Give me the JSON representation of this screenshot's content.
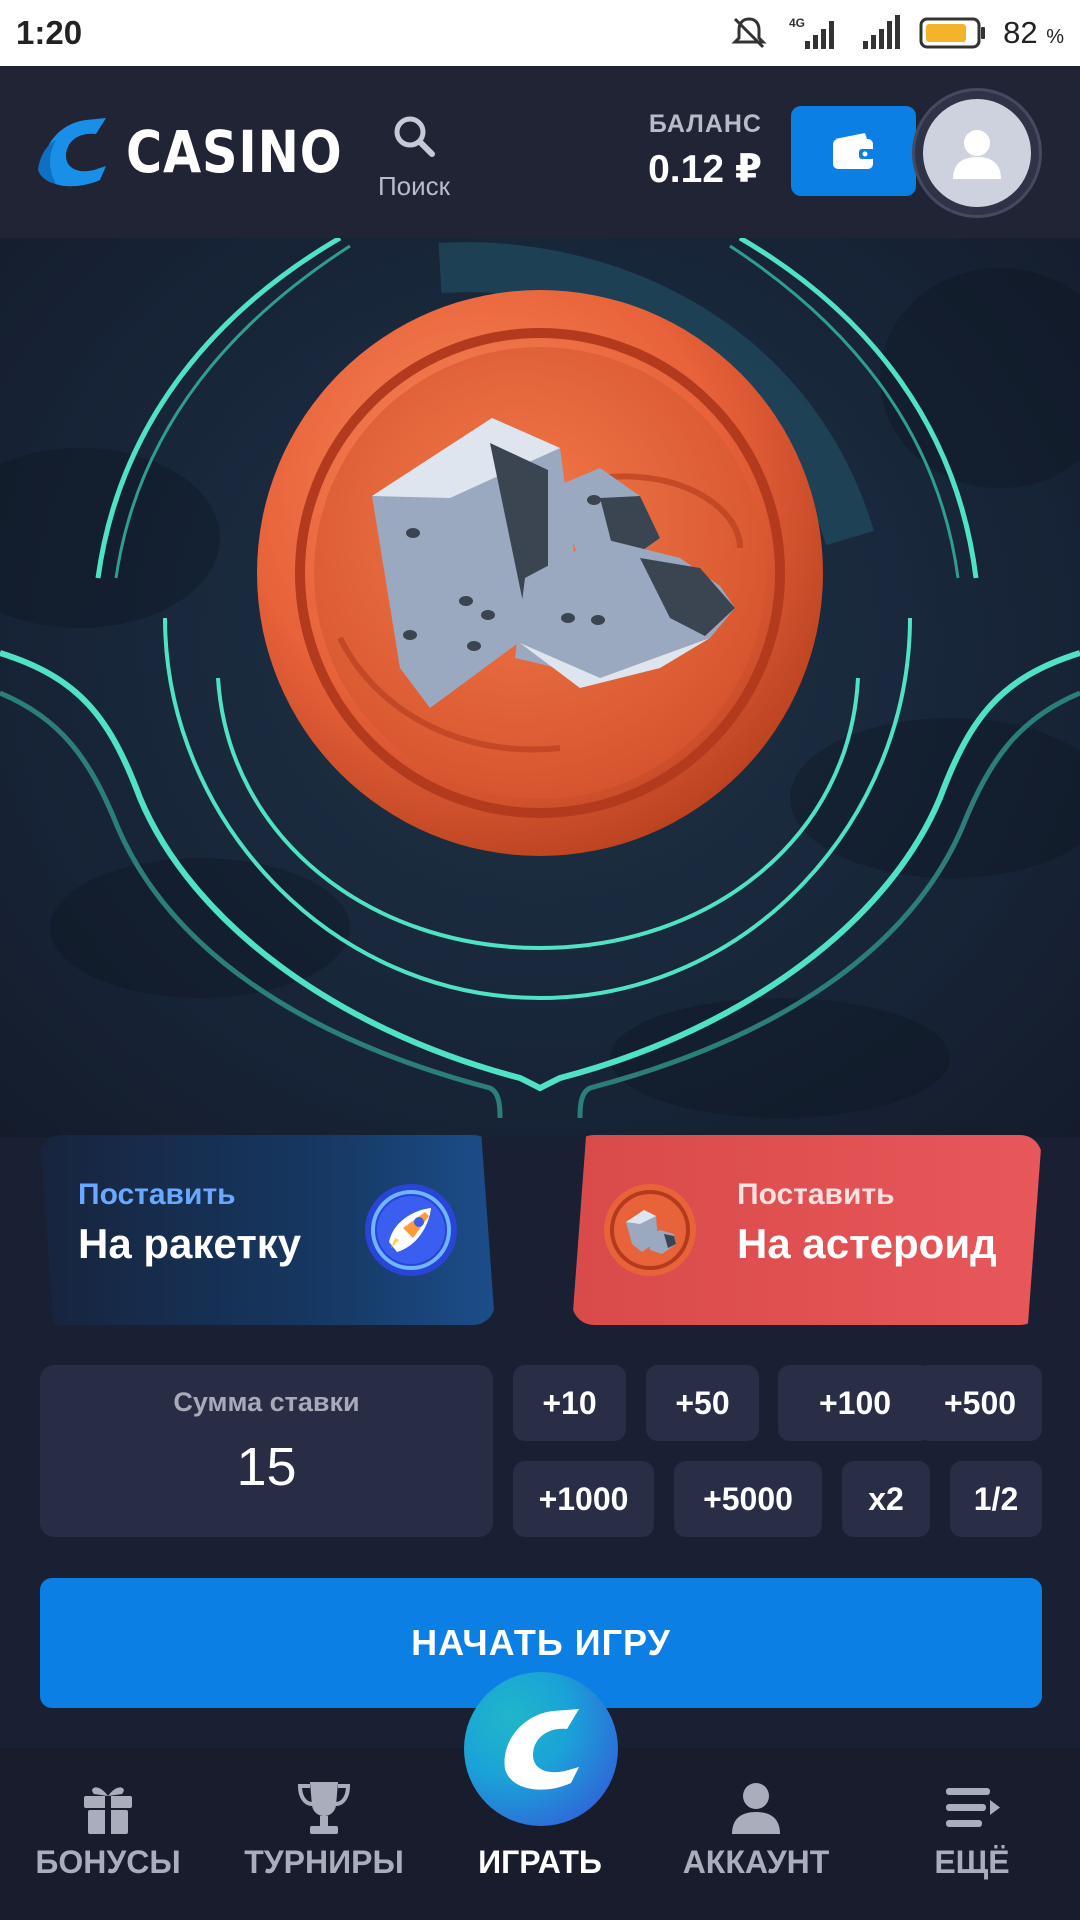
{
  "status_bar": {
    "time": "1:20",
    "network": "4G",
    "battery_percent": "82",
    "battery_unit": "%"
  },
  "header": {
    "logo_text": "CASINO",
    "search_label": "Поиск",
    "balance_label": "БАЛАНС",
    "balance_value": "0.12 ₽"
  },
  "bets": {
    "rocket": {
      "small": "Поставить",
      "big": "На ракетку"
    },
    "asteroid": {
      "small": "Поставить",
      "big": "На астероид"
    }
  },
  "stake": {
    "label": "Сумма ставки",
    "value": "15",
    "chips": [
      "+10",
      "+50",
      "+100",
      "+500",
      "+1000",
      "+5000",
      "x2",
      "1/2"
    ]
  },
  "start_button": "НАЧАТЬ ИГРУ",
  "nav": {
    "bonuses": "БОНУСЫ",
    "tournaments": "ТУРНИРЫ",
    "play": "ИГРАТЬ",
    "account": "АККАУНТ",
    "more": "ЕЩЁ"
  },
  "colors": {
    "accent_blue": "#0b7fe3",
    "asteroid_red": "#e8575a",
    "neon_teal": "#4fe3c4",
    "coin_orange": "#e8623a"
  },
  "icons": [
    "mute-icon",
    "signal-icon",
    "battery-icon",
    "search-icon",
    "wallet-icon",
    "user-icon",
    "gift-icon",
    "trophy-icon",
    "account-icon",
    "menu-icon",
    "asteroid-icon",
    "rocket-icon"
  ]
}
